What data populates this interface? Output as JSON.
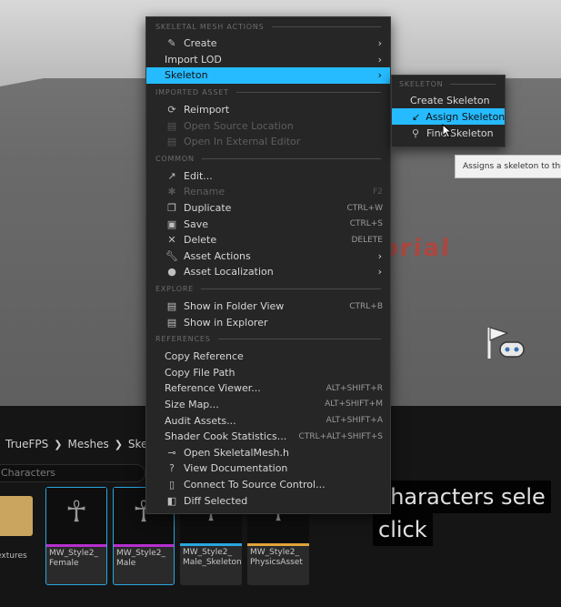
{
  "viewport": {
    "watermark_text": "orial"
  },
  "browser": {
    "breadcrumbs": [
      "TrueFPS",
      "Meshes",
      "Ske"
    ],
    "search_placeholder": "Characters",
    "folder_label": "extures",
    "assets": [
      {
        "name": "MW_Style2_\nFemale",
        "stripe": "#b62fcf",
        "selected": true
      },
      {
        "name": "MW_Style2_\nMale",
        "stripe": "#b62fcf",
        "selected": true
      },
      {
        "name": "MW_Style2_\nMale_Skeleton",
        "stripe": "#2aa7e0",
        "selected": false
      },
      {
        "name": "MW_Style2_\nPhysicsAsset",
        "stripe": "#e0a43a",
        "selected": false
      }
    ]
  },
  "caption": {
    "line1": "characters sele",
    "line2": "click"
  },
  "menu": {
    "sections": {
      "skeletal": "SKELETAL MESH ACTIONS",
      "imported": "IMPORTED ASSET",
      "common": "COMMON",
      "explore": "EXPLORE",
      "references": "REFERENCES"
    },
    "skeletal_items": [
      {
        "label": "Create",
        "icon": "create-icon",
        "submenu": true
      },
      {
        "label": "Import LOD",
        "submenu": true
      },
      {
        "label": "Skeleton",
        "submenu": true,
        "highlighted": true
      }
    ],
    "imported_items": [
      {
        "label": "Reimport",
        "icon": "reimport-icon"
      },
      {
        "label": "Open Source Location",
        "icon": "folder-icon",
        "disabled": true
      },
      {
        "label": "Open In External Editor",
        "icon": "external-icon",
        "disabled": true
      }
    ],
    "common_items": [
      {
        "label": "Edit...",
        "icon": "edit-icon"
      },
      {
        "label": "Rename",
        "icon": "rename-icon",
        "shortcut": "F2",
        "disabled": true
      },
      {
        "label": "Duplicate",
        "icon": "duplicate-icon",
        "shortcut": "CTRL+W"
      },
      {
        "label": "Save",
        "icon": "save-icon",
        "shortcut": "CTRL+S"
      },
      {
        "label": "Delete",
        "icon": "delete-icon",
        "shortcut": "DELETE"
      },
      {
        "label": "Asset Actions",
        "icon": "wrench-icon",
        "submenu": true
      },
      {
        "label": "Asset Localization",
        "icon": "globe-icon",
        "submenu": true
      }
    ],
    "explore_items": [
      {
        "label": "Show in Folder View",
        "icon": "folder-icon",
        "shortcut": "CTRL+B"
      },
      {
        "label": "Show in Explorer",
        "icon": "folder-icon"
      }
    ],
    "references_items": [
      {
        "label": "Copy Reference"
      },
      {
        "label": "Copy File Path"
      },
      {
        "label": "Reference Viewer...",
        "shortcut": "ALT+SHIFT+R"
      },
      {
        "label": "Size Map...",
        "shortcut": "ALT+SHIFT+M"
      },
      {
        "label": "Audit Assets...",
        "shortcut": "ALT+SHIFT+A"
      },
      {
        "label": "Shader Cook Statistics...",
        "shortcut": "CTRL+ALT+SHIFT+S"
      },
      {
        "label": "Open SkeletalMesh.h",
        "icon": "code-icon"
      },
      {
        "label": "View Documentation",
        "icon": "help-icon"
      },
      {
        "label": "Connect To Source Control...",
        "icon": "lock-icon"
      },
      {
        "label": "Diff Selected",
        "icon": "diff-icon"
      }
    ]
  },
  "submenu": {
    "section": "SKELETON",
    "items": [
      {
        "label": "Create Skeleton"
      },
      {
        "label": "Assign Skeleton",
        "icon": "assign-skeleton-icon",
        "highlighted": true
      },
      {
        "label": "Find Skeleton",
        "icon": "find-skeleton-icon"
      }
    ]
  },
  "tooltip": {
    "text": "Assigns a skeleton to the"
  }
}
